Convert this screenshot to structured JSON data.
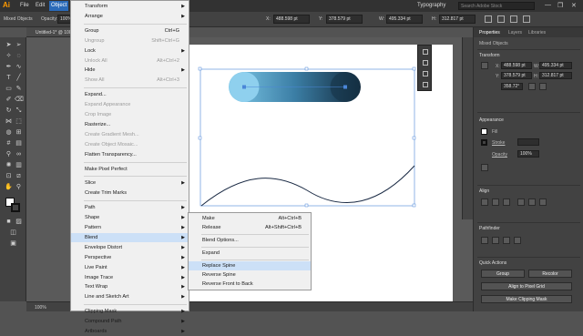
{
  "app": {
    "logo": "Ai"
  },
  "menubar": {
    "items": [
      "File",
      "Edit",
      "Object"
    ],
    "workspace": "Typography",
    "search_placeholder": "Search Adobe Stock",
    "window_controls": [
      "—",
      "❐",
      "✕"
    ]
  },
  "control_bar": {
    "selection_label": "Mixed Objects",
    "opacity_label": "Opacity:",
    "opacity_value": "100%",
    "x_label": "X:",
    "x_value": "488.598 pt",
    "y_label": "Y:",
    "y_value": "378.579 pt",
    "w_label": "W:",
    "w_value": "495.334 pt",
    "h_label": "H:",
    "h_value": "312.817 pt"
  },
  "document": {
    "tab_title": "Untitled-1* @ 100%"
  },
  "status": {
    "zoom": "100%"
  },
  "object_menu": {
    "items": [
      {
        "label": "Transform",
        "sub": true
      },
      {
        "label": "Arrange",
        "sub": true
      },
      {
        "sep": true
      },
      {
        "label": "Group",
        "shortcut": "Ctrl+G"
      },
      {
        "label": "Ungroup",
        "shortcut": "Shift+Ctrl+G",
        "disabled": true
      },
      {
        "label": "Lock",
        "sub": true
      },
      {
        "label": "Unlock All",
        "shortcut": "Alt+Ctrl+2",
        "disabled": true
      },
      {
        "label": "Hide",
        "sub": true
      },
      {
        "label": "Show All",
        "shortcut": "Alt+Ctrl+3",
        "disabled": true
      },
      {
        "sep": true
      },
      {
        "label": "Expand..."
      },
      {
        "label": "Expand Appearance",
        "disabled": true
      },
      {
        "label": "Crop Image",
        "disabled": true
      },
      {
        "label": "Rasterize..."
      },
      {
        "label": "Create Gradient Mesh...",
        "disabled": true
      },
      {
        "label": "Create Object Mosaic...",
        "disabled": true
      },
      {
        "label": "Flatten Transparency..."
      },
      {
        "sep": true
      },
      {
        "label": "Make Pixel Perfect"
      },
      {
        "sep": true
      },
      {
        "label": "Slice",
        "sub": true
      },
      {
        "label": "Create Trim Marks"
      },
      {
        "sep": true
      },
      {
        "label": "Path",
        "sub": true
      },
      {
        "label": "Shape",
        "sub": true
      },
      {
        "label": "Pattern",
        "sub": true
      },
      {
        "label": "Blend",
        "sub": true,
        "highlight": true
      },
      {
        "label": "Envelope Distort",
        "sub": true
      },
      {
        "label": "Perspective",
        "sub": true
      },
      {
        "label": "Live Paint",
        "sub": true
      },
      {
        "label": "Image Trace",
        "sub": true
      },
      {
        "label": "Text Wrap",
        "sub": true
      },
      {
        "label": "Line and Sketch Art",
        "sub": true
      },
      {
        "sep": true
      },
      {
        "label": "Clipping Mask",
        "sub": true
      },
      {
        "label": "Compound Path",
        "sub": true
      },
      {
        "label": "Artboards",
        "sub": true
      }
    ]
  },
  "blend_submenu": {
    "items": [
      {
        "label": "Make",
        "shortcut": "Alt+Ctrl+B"
      },
      {
        "label": "Release",
        "shortcut": "Alt+Shift+Ctrl+B"
      },
      {
        "sep": true
      },
      {
        "label": "Blend Options..."
      },
      {
        "sep": true
      },
      {
        "label": "Expand"
      },
      {
        "sep": true
      },
      {
        "label": "Replace Spine",
        "highlight": true
      },
      {
        "label": "Reverse Spine"
      },
      {
        "label": "Reverse Front to Back"
      }
    ]
  },
  "right_panel": {
    "tabs": [
      "Properties",
      "Layers",
      "Libraries"
    ],
    "selection": "Mixed Objects",
    "transform_title": "Transform",
    "x_label": "X:",
    "x_value": "488.598 pt",
    "y_label": "Y:",
    "y_value": "378.579 pt",
    "w_label": "W:",
    "w_value": "495.334 pt",
    "h_label": "H:",
    "h_value": "312.817 pt",
    "angle_value": "358.72°",
    "appearance_title": "Appearance",
    "fill_label": "Fill",
    "stroke_label": "Stroke",
    "opacity_label": "Opacity",
    "opacity_value": "100%",
    "align_title": "Align",
    "pathfinder_title": "Pathfinder",
    "quick_actions_title": "Quick Actions",
    "btn_group": "Group",
    "btn_recolor": "Recolor",
    "btn_align_pixel": "Align to Pixel Grid",
    "btn_clipping": "Make Clipping Mask"
  },
  "colors": {
    "accent": "#2a6ab8",
    "menu_highlight": "#cce0f7",
    "blend_start": "#7ec8e8",
    "blend_end": "#1a3a52"
  }
}
